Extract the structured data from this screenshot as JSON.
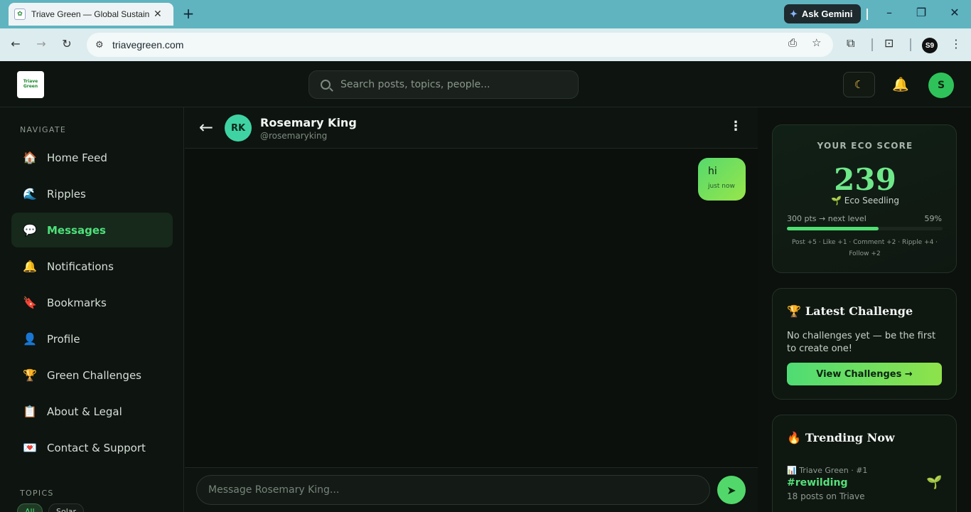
{
  "browser": {
    "tab_title": "Triave Green — Global Sustainability",
    "url": "triavegreen.com",
    "ask_gemini": "Ask Gemini",
    "profile_initials": "S9"
  },
  "header": {
    "logo_text": "Triave Green",
    "search_placeholder": "Search posts, topics, people...",
    "avatar_initial": "S"
  },
  "sidebar": {
    "nav_heading": "NAVIGATE",
    "items": [
      {
        "label": "Home Feed",
        "icon": "house-icon"
      },
      {
        "label": "Ripples",
        "icon": "wave-icon"
      },
      {
        "label": "Messages",
        "icon": "speech-bubble-icon"
      },
      {
        "label": "Notifications",
        "icon": "bell-icon"
      },
      {
        "label": "Bookmarks",
        "icon": "bookmark-icon"
      },
      {
        "label": "Profile",
        "icon": "person-icon"
      },
      {
        "label": "Green Challenges",
        "icon": "trophy-icon"
      },
      {
        "label": "About & Legal",
        "icon": "clipboard-icon"
      },
      {
        "label": "Contact & Support",
        "icon": "heart-letter-icon"
      }
    ],
    "active_index": 2,
    "topics_heading": "TOPICS",
    "topic_chips": [
      "All",
      "Solar"
    ]
  },
  "chat": {
    "avatar_initials": "RK",
    "name": "Rosemary King",
    "handle": "@rosemaryking",
    "messages": [
      {
        "text": "hi",
        "time": "just now",
        "outgoing": true
      }
    ],
    "composer_placeholder": "Message Rosemary King..."
  },
  "eco_score": {
    "heading": "YOUR ECO SCORE",
    "score": "239",
    "level": "🌱 Eco Seedling",
    "progress_label": "300 pts → next level",
    "progress_pct": "59%",
    "progress_value": 0.59,
    "points_info": "Post +5 · Like +1 · Comment +2 · Ripple +4 · Follow +2"
  },
  "challenge": {
    "title": "Latest Challenge",
    "text": "No challenges yet — be the first to create one!",
    "button": "View Challenges →"
  },
  "trending": {
    "title": "Trending Now",
    "items": [
      {
        "meta": "Triave Green · #1",
        "tag": "#rewilding",
        "count": "18 posts on Triave"
      }
    ]
  },
  "colors": {
    "accent": "#4fe07a",
    "background": "#0c110d",
    "chat_avatar": "#3fd3a3"
  }
}
